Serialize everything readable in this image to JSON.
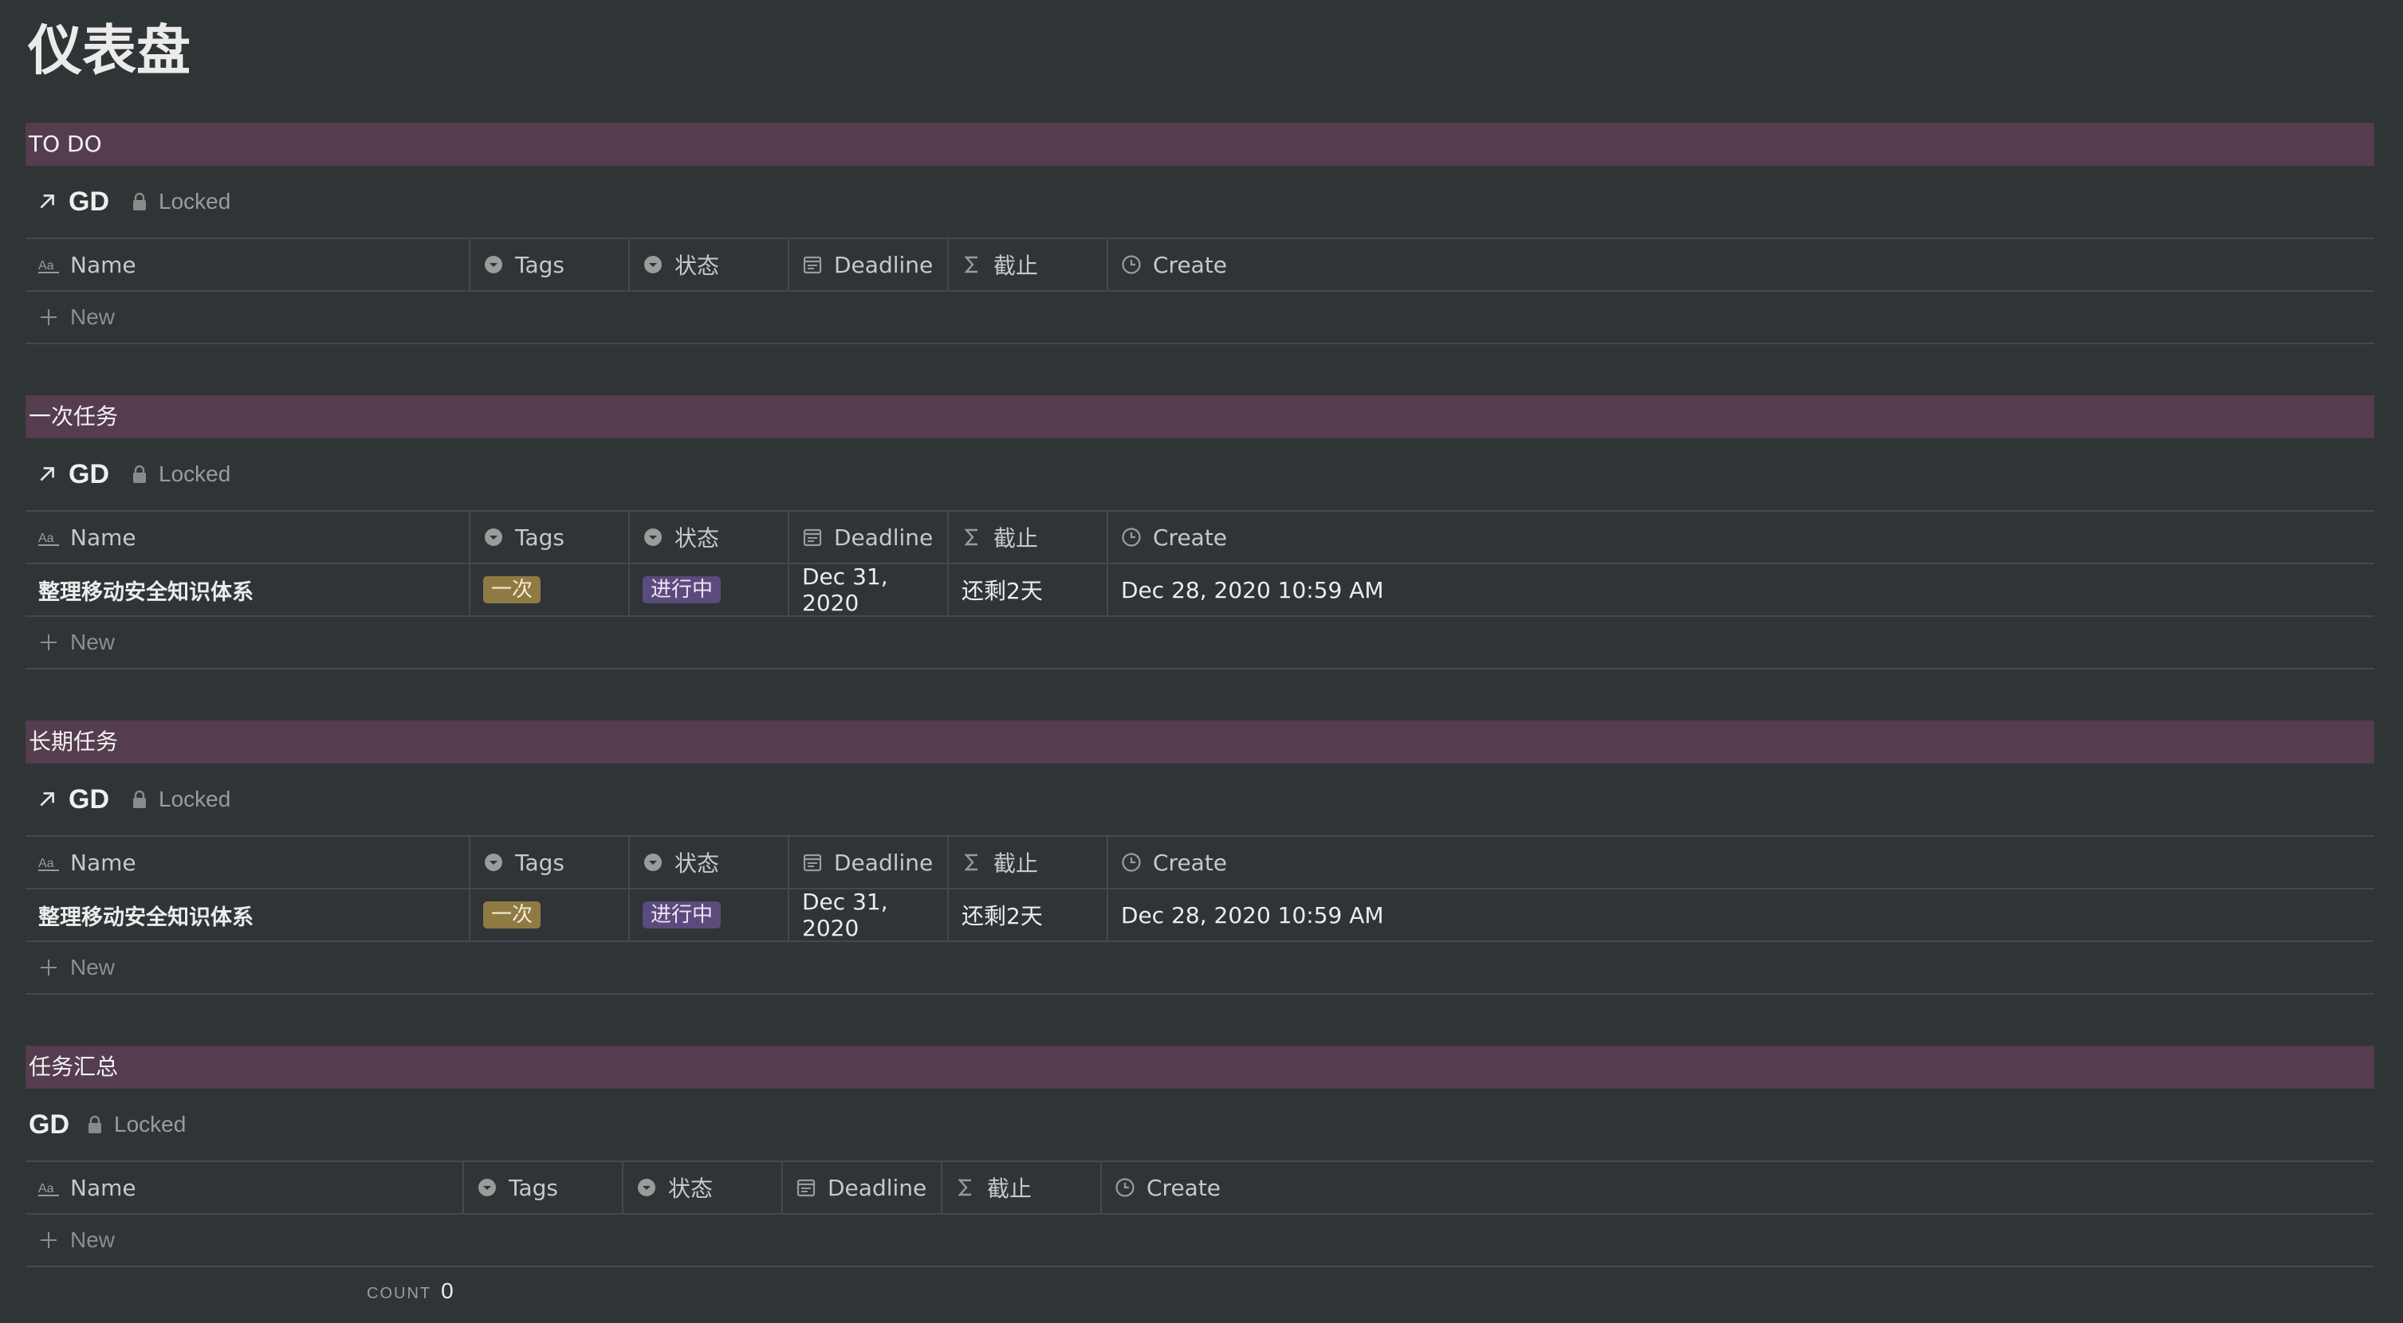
{
  "page": {
    "title": "仪表盘"
  },
  "colors": {
    "background": "#2f3437",
    "callout": "#553c4e",
    "tag_once": "#8f7a44",
    "status_in_progress": "#5b4a7c"
  },
  "columns": {
    "name": "Name",
    "tags": "Tags",
    "state": "状态",
    "deadline": "Deadline",
    "cutoff": "截止",
    "create": "Create"
  },
  "icons": {
    "name": "text-property-icon",
    "tags": "select-property-icon",
    "state": "select-property-icon",
    "deadline": "calendar-icon",
    "cutoff": "sigma-formula-icon",
    "create": "clock-icon"
  },
  "sections": [
    {
      "callout": "TO DO",
      "db_name": "GD",
      "locked_label": "Locked",
      "new_label": "New",
      "rows": []
    },
    {
      "callout": "一次任务",
      "db_name": "GD",
      "locked_label": "Locked",
      "new_label": "New",
      "rows": [
        {
          "name": "整理移动安全知识体系",
          "tag": "一次",
          "state": "进行中",
          "deadline": "Dec 31, 2020",
          "cutoff": "还剩2天",
          "create": "Dec 28, 2020 10:59 AM"
        }
      ]
    },
    {
      "callout": "长期任务",
      "db_name": "GD",
      "locked_label": "Locked",
      "new_label": "New",
      "rows": [
        {
          "name": "整理移动安全知识体系",
          "tag": "一次",
          "state": "进行中",
          "deadline": "Dec 31, 2020",
          "cutoff": "还剩2天",
          "create": "Dec 28, 2020 10:59 AM"
        }
      ]
    },
    {
      "callout": "任务汇总",
      "db_name": "GD",
      "locked_label": "Locked",
      "new_label": "New",
      "count_label": "COUNT",
      "count_value": "0",
      "rows": []
    }
  ]
}
